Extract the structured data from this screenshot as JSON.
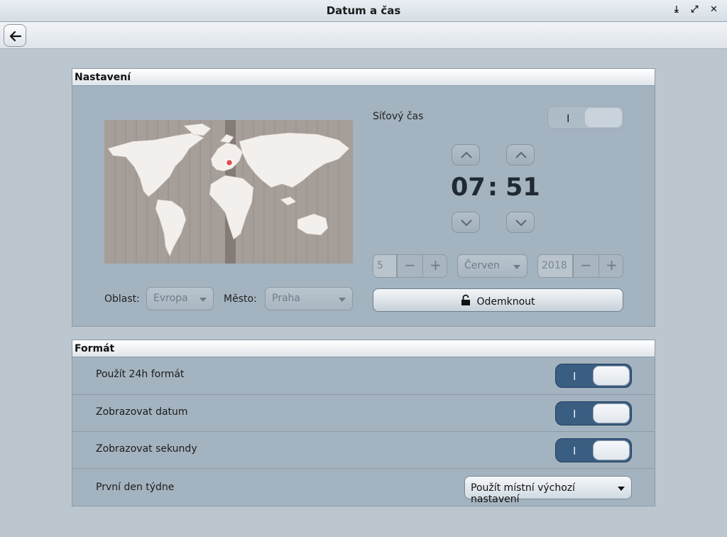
{
  "window": {
    "title": "Datum a čas",
    "minimize_glyph": "⤓",
    "maximize_glyph": "⤢",
    "close_glyph": "✕"
  },
  "toolbar": {
    "back_icon": "arrow-left-icon"
  },
  "settings": {
    "header": "Nastavení",
    "region_label": "Oblast:",
    "region_value": "Evropa",
    "city_label": "Město:",
    "city_value": "Praha",
    "network_time_label": "Síťový čas",
    "network_time_toggle_glyph": "I",
    "network_time_enabled": false,
    "hours": "07",
    "separator": ":",
    "minutes": "51",
    "day": "5",
    "month": "Červen",
    "year": "2018",
    "minus": "−",
    "plus": "+",
    "unlock_label": "Odemknout",
    "marker_color": "#e84a4a"
  },
  "format": {
    "header": "Formát",
    "rows": [
      {
        "label": "Použít 24h formát",
        "toggle_glyph": "I",
        "enabled": true
      },
      {
        "label": "Zobrazovat datum",
        "toggle_glyph": "I",
        "enabled": true
      },
      {
        "label": "Zobrazovat sekundy",
        "toggle_glyph": "I",
        "enabled": true
      }
    ],
    "first_day_label": "První den týdne",
    "first_day_value": "Použít místní výchozí nastavení"
  },
  "colors": {
    "accent": "#3a5d82",
    "panel": "#a4b3c0",
    "background": "#bcc6ce"
  }
}
